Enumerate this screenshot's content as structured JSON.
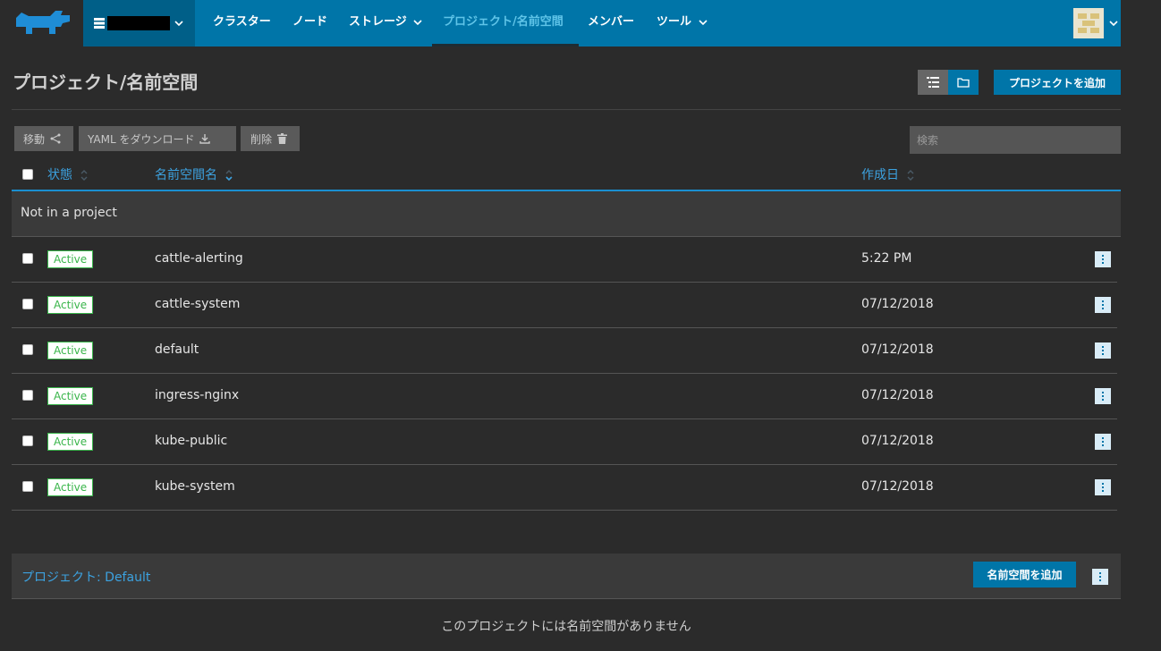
{
  "header": {
    "cluster_name": "",
    "nav": [
      {
        "label": "クラスター",
        "dropdown": false,
        "active": false
      },
      {
        "label": "ノード",
        "dropdown": false,
        "active": false
      },
      {
        "label": "ストレージ",
        "dropdown": true,
        "active": false
      },
      {
        "label": "プロジェクト/名前空間",
        "dropdown": false,
        "active": true
      },
      {
        "label": "メンバー",
        "dropdown": false,
        "active": false
      },
      {
        "label": "ツール",
        "dropdown": true,
        "active": false
      }
    ]
  },
  "page": {
    "title": "プロジェクト/名前空間",
    "add_project_label": "プロジェクトを追加"
  },
  "bulk_actions": {
    "move_label": "移動",
    "yaml_label": "YAML をダウンロード",
    "delete_label": "削除"
  },
  "search": {
    "placeholder": "検索",
    "value": ""
  },
  "table": {
    "columns": {
      "state": "状態",
      "name": "名前空間名",
      "created": "作成日"
    },
    "group_label": "Not in a project",
    "rows": [
      {
        "state": "Active",
        "name": "cattle-alerting",
        "created": "5:22 PM"
      },
      {
        "state": "Active",
        "name": "cattle-system",
        "created": "07/12/2018"
      },
      {
        "state": "Active",
        "name": "default",
        "created": "07/12/2018"
      },
      {
        "state": "Active",
        "name": "ingress-nginx",
        "created": "07/12/2018"
      },
      {
        "state": "Active",
        "name": "kube-public",
        "created": "07/12/2018"
      },
      {
        "state": "Active",
        "name": "kube-system",
        "created": "07/12/2018"
      }
    ]
  },
  "project_section": {
    "project_label": "プロジェクト: Default",
    "add_namespace_label": "名前空間を追加",
    "empty_message": "このプロジェクトには名前空間がありません"
  },
  "colors": {
    "nav_bg": "#0075a8",
    "accent": "#3ca2e0",
    "active_green": "#39b54a",
    "background": "#2b2b2b"
  }
}
